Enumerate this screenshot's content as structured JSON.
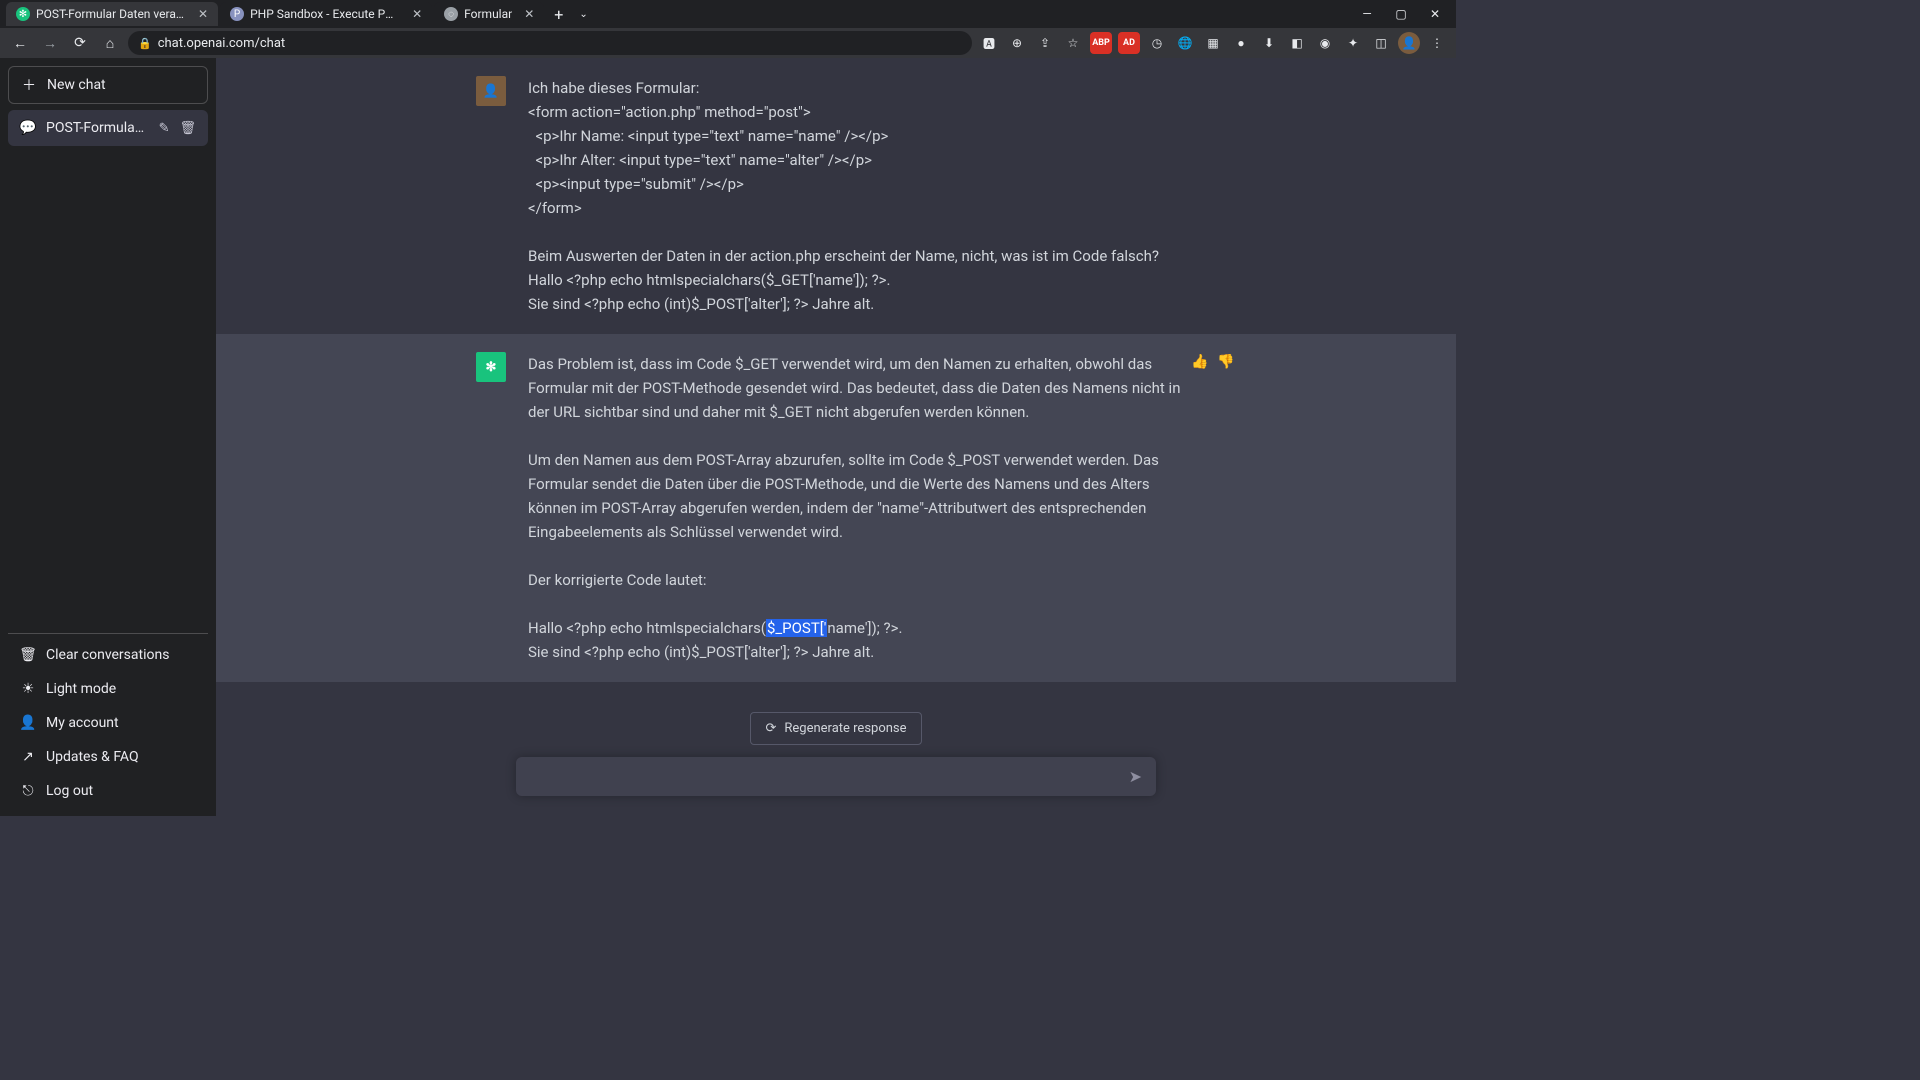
{
  "browser": {
    "tabs": [
      {
        "title": "POST-Formular Daten verarbeite",
        "active": true
      },
      {
        "title": "PHP Sandbox - Execute PHP cod",
        "active": false
      },
      {
        "title": "Formular",
        "active": false
      }
    ],
    "url": "chat.openai.com/chat"
  },
  "sidebar": {
    "new_chat": "New chat",
    "history": [
      {
        "title": "POST-Formular Daten v"
      }
    ],
    "footer": {
      "clear": "Clear conversations",
      "light": "Light mode",
      "account": "My account",
      "updates": "Updates & FAQ",
      "logout": "Log out"
    }
  },
  "conversation": {
    "user_msg": "Ich habe dieses Formular:\n<form action=\"action.php\" method=\"post\">\n  <p>Ihr Name: <input type=\"text\" name=\"name\" /></p>\n  <p>Ihr Alter: <input type=\"text\" name=\"alter\" /></p>\n  <p><input type=\"submit\" /></p>\n</form>\n\nBeim Auswerten der Daten in der action.php erscheint der Name, nicht, was ist im Code falsch?\nHallo <?php echo htmlspecialchars($_GET['name']); ?>.\nSie sind <?php echo (int)$_POST['alter']; ?> Jahre alt.",
    "bot_p1": "Das Problem ist, dass im Code $_GET verwendet wird, um den Namen zu erhalten, obwohl das Formular mit der POST-Methode gesendet wird. Das bedeutet, dass die Daten des Namens nicht in der URL sichtbar sind und daher mit $_GET nicht abgerufen werden können.",
    "bot_p2": "Um den Namen aus dem POST-Array abzurufen, sollte im Code $_POST verwendet werden. Das Formular sendet die Daten über die POST-Methode, und die Werte des Namens und des Alters können im POST-Array abgerufen werden, indem der \"name\"-Attributwert des entsprechenden Eingabeelements als Schlüssel verwendet wird.",
    "bot_p3": "Der korrigierte Code lautet:",
    "bot_code_pre": "Hallo <?php echo htmlspecialchars(",
    "bot_code_hl": "$_POST['",
    "bot_code_post": "name']); ?>.\nSie sind <?php echo (int)$_POST['alter']; ?> Jahre alt."
  },
  "actions": {
    "regenerate": "Regenerate response"
  }
}
